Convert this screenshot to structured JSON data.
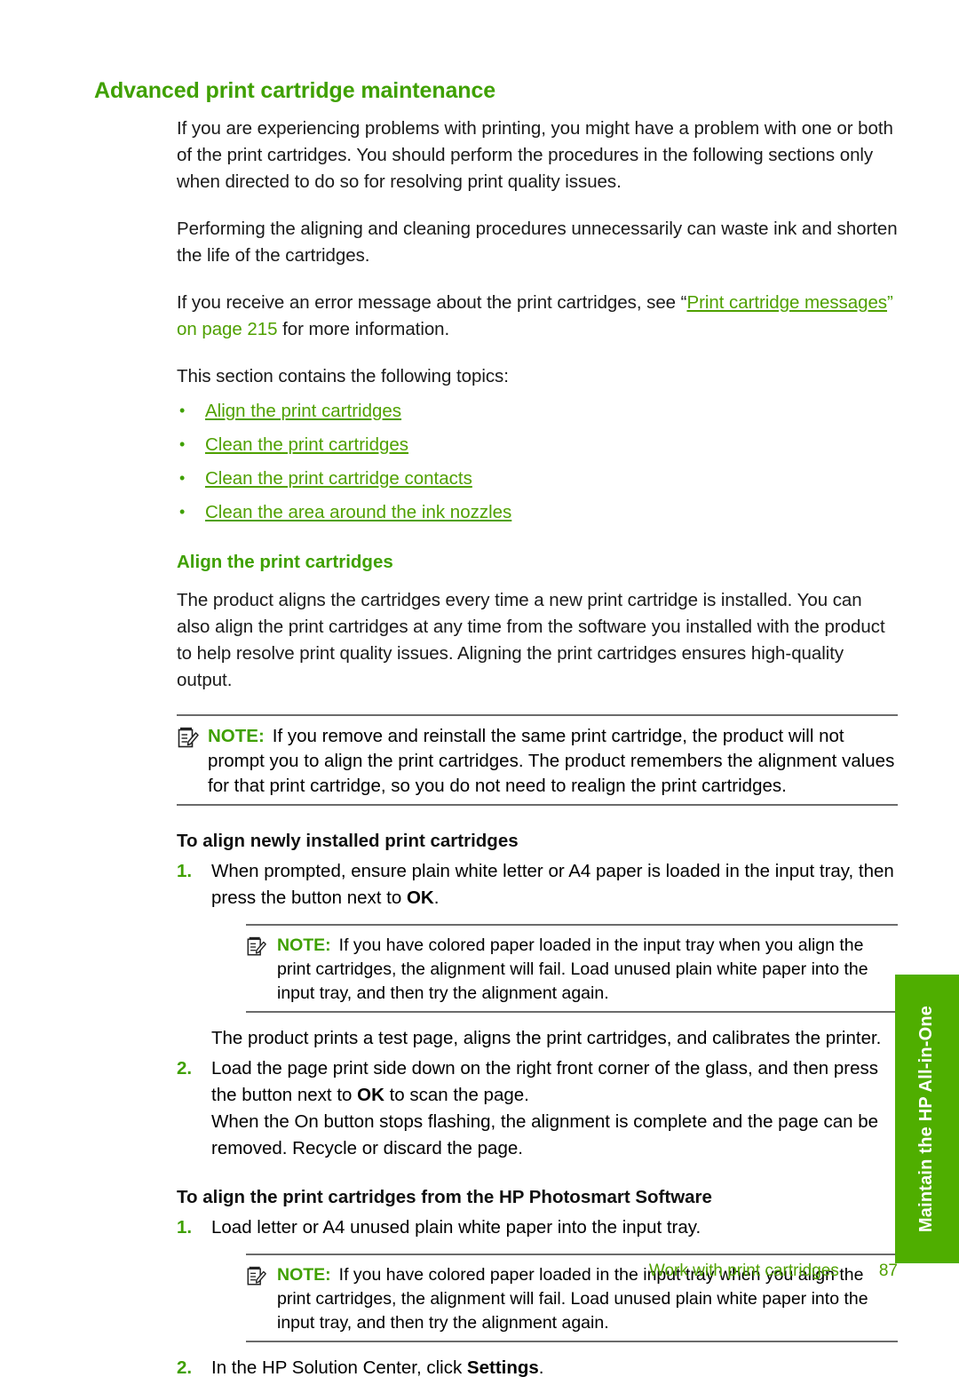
{
  "document": {
    "heading": "Advanced print cartridge maintenance",
    "intro_paragraphs": [
      "If you are experiencing problems with printing, you might have a problem with one or both of the print cartridges. You should perform the procedures in the following sections only when directed to do so for resolving print quality issues.",
      "Performing the aligning and cleaning procedures unnecessarily can waste ink and shorten the life of the cartridges."
    ],
    "xref_sentence": {
      "before": "If you receive an error message about the print cartridges, see “",
      "link": "Print cartridge messages",
      "after_quote": "” ",
      "page_ref": "on page 215",
      "after": " for more information."
    },
    "topics_intro": "This section contains the following topics:",
    "topics": [
      "Align the print cartridges",
      "Clean the print cartridges",
      "Clean the print cartridge contacts",
      "Clean the area around the ink nozzles"
    ],
    "section": {
      "heading": "Align the print cartridges",
      "paragraph": "The product aligns the cartridges every time a new print cartridge is installed. You can also align the print cartridges at any time from the software you installed with the product to help resolve print quality issues. Aligning the print cartridges ensures high-quality output.",
      "note": {
        "label": "NOTE:",
        "text": "If you remove and reinstall the same print cartridge, the product will not prompt you to align the print cartridges. The product remembers the alignment values for that print cartridge, so you do not need to realign the print cartridges."
      }
    },
    "procedure_1": {
      "heading": "To align newly installed print cartridges",
      "step1": {
        "number": "1.",
        "text_before": "When prompted, ensure plain white letter or A4 paper is loaded in the input tray, then press the button next to ",
        "bold": "OK",
        "text_after": "."
      },
      "step1_note": {
        "label": "NOTE:",
        "text": "If you have colored paper loaded in the input tray when you align the print cartridges, the alignment will fail. Load unused plain white paper into the input tray, and then try the alignment again."
      },
      "step1_after": "The product prints a test page, aligns the print cartridges, and calibrates the printer.",
      "step2": {
        "number": "2.",
        "text_before": "Load the page print side down on the right front corner of the glass, and then press the button next to ",
        "bold": "OK",
        "text_after": " to scan the page."
      },
      "step2_after": "When the On button stops flashing, the alignment is complete and the page can be removed. Recycle or discard the page."
    },
    "procedure_2": {
      "heading": "To align the print cartridges from the HP Photosmart Software",
      "step1": {
        "number": "1.",
        "text": "Load letter or A4 unused plain white paper into the input tray."
      },
      "step1_note": {
        "label": "NOTE:",
        "text": "If you have colored paper loaded in the input tray when you align the print cartridges, the alignment will fail. Load unused plain white paper into the input tray, and then try the alignment again."
      },
      "step2": {
        "number": "2.",
        "text_before": "In the HP Solution Center, click ",
        "bold": "Settings",
        "text_after": "."
      }
    },
    "side_tab": {
      "label": "Maintain the HP All-in-One"
    },
    "footer": {
      "chapter_title": "Work with print cartridges",
      "page_number": "87"
    },
    "colors": {
      "heading_green": "#3FA000",
      "link_green": "#4FA000",
      "tab_green": "#4FAE00",
      "rule_gray": "#6b6b6b"
    }
  }
}
